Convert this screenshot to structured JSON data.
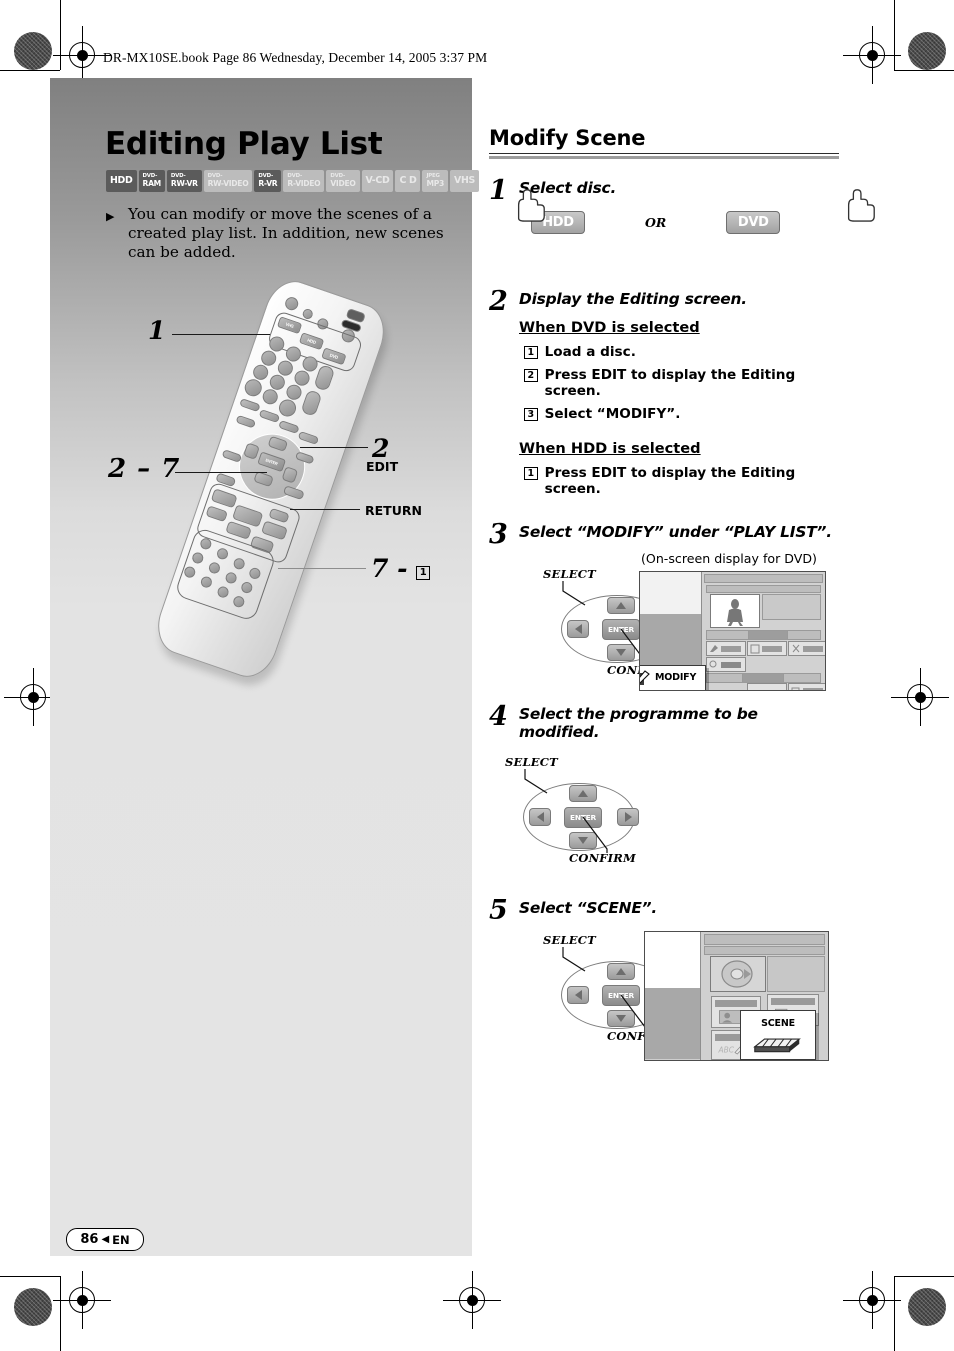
{
  "header": {
    "book_line": "DR-MX10SE.book  Page 86  Wednesday, December 14, 2005  3:37 PM"
  },
  "left": {
    "title": "Editing Play List",
    "badges": [
      {
        "prefix": "",
        "main": "HDD",
        "active": true
      },
      {
        "prefix": "DVD-",
        "main": "RAM",
        "active": true
      },
      {
        "prefix": "DVD-",
        "main": "RW-VR",
        "active": true
      },
      {
        "prefix": "DVD-",
        "main": "RW-VIDEO",
        "active": false
      },
      {
        "prefix": "DVD-",
        "main": "R-VR",
        "active": true
      },
      {
        "prefix": "DVD-",
        "main": "R-VIDEO",
        "active": false
      },
      {
        "prefix": "DVD-",
        "main": "VIDEO",
        "active": false
      },
      {
        "prefix": "",
        "main": "V-CD",
        "active": false
      },
      {
        "prefix": "",
        "main": "C D",
        "active": false
      },
      {
        "prefix": "JPEG",
        "main": "MP3",
        "active": false
      },
      {
        "prefix": "",
        "main": "VHS",
        "active": false
      }
    ],
    "intro": "You can modify or move the scenes of a created play list. In addition, new scenes can be added.",
    "remote_callouts": {
      "source_keys": "1",
      "edit_number": "2",
      "edit_label": "EDIT",
      "arrow_pad": "2 – 7",
      "return_label": "RETURN",
      "pause_number": "7 -",
      "pause_boxnum": "1"
    },
    "remote_keys": {
      "vhs": "VHS",
      "hdd": "HDD",
      "dvd": "DVD",
      "enter": "ENTER"
    }
  },
  "footer": {
    "page": "86",
    "arrow": "◀",
    "lang": "EN"
  },
  "right": {
    "heading": "Modify Scene",
    "steps": [
      {
        "num": "1",
        "title": "Select disc.",
        "disc_buttons": {
          "hdd": "HDD",
          "or": "OR",
          "dvd": "DVD"
        }
      },
      {
        "num": "2",
        "title": "Display the Editing screen.",
        "groups": [
          {
            "subhead": "When DVD is selected",
            "items": [
              {
                "n": "1",
                "text": "Load a disc."
              },
              {
                "n": "2",
                "text": "Press EDIT to display the Editing screen."
              },
              {
                "n": "3",
                "text": "Select “MODIFY”."
              }
            ]
          },
          {
            "subhead": "When HDD is selected",
            "items": [
              {
                "n": "1",
                "text": "Press EDIT to display the Editing screen."
              }
            ]
          }
        ]
      },
      {
        "num": "3",
        "title": "Select “MODIFY” under “PLAY LIST”.",
        "dpad": {
          "select": "SELECT",
          "confirm": "CONFIRM",
          "enter": "ENTER"
        },
        "osd_caption": "(On-screen display for DVD)",
        "osd_popup": "MODIFY"
      },
      {
        "num": "4",
        "title": "Select the programme to be modified.",
        "dpad": {
          "select": "SELECT",
          "confirm": "CONFIRM",
          "enter": "ENTER"
        }
      },
      {
        "num": "5",
        "title": "Select “SCENE”.",
        "dpad": {
          "select": "SELECT",
          "confirm": "CONFIRM",
          "enter": "ENTER"
        },
        "osd_popup": "SCENE"
      }
    ]
  },
  "colors": {
    "panel_top": "#808080",
    "panel_bottom": "#e4e4e4",
    "badge_on": "#5b5b5b",
    "badge_off": "#bcbcbc"
  }
}
